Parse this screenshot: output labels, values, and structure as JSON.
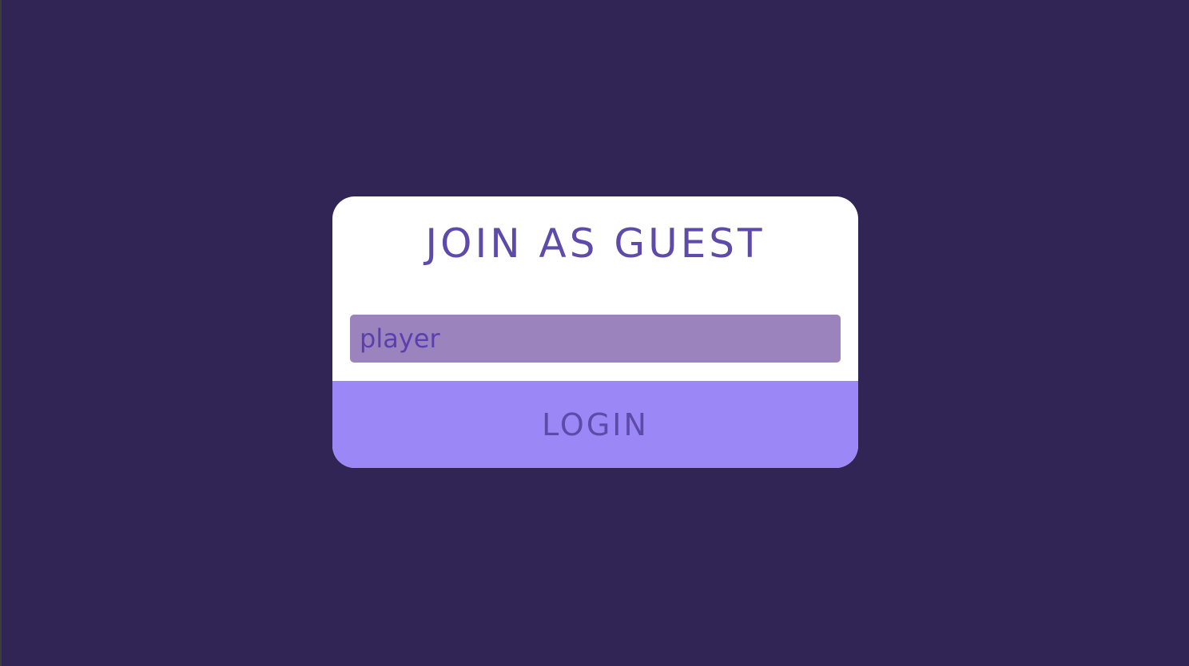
{
  "login_card": {
    "title": "JOIN AS GUEST",
    "name_input": {
      "value": "player",
      "placeholder": ""
    },
    "login_button_label": "LOGIN"
  },
  "colors": {
    "background": "#302555",
    "card": "#ffffff",
    "accent_text": "#5e4aa8",
    "input_fill": "#9b83bd",
    "button_fill": "#9b87f5"
  }
}
